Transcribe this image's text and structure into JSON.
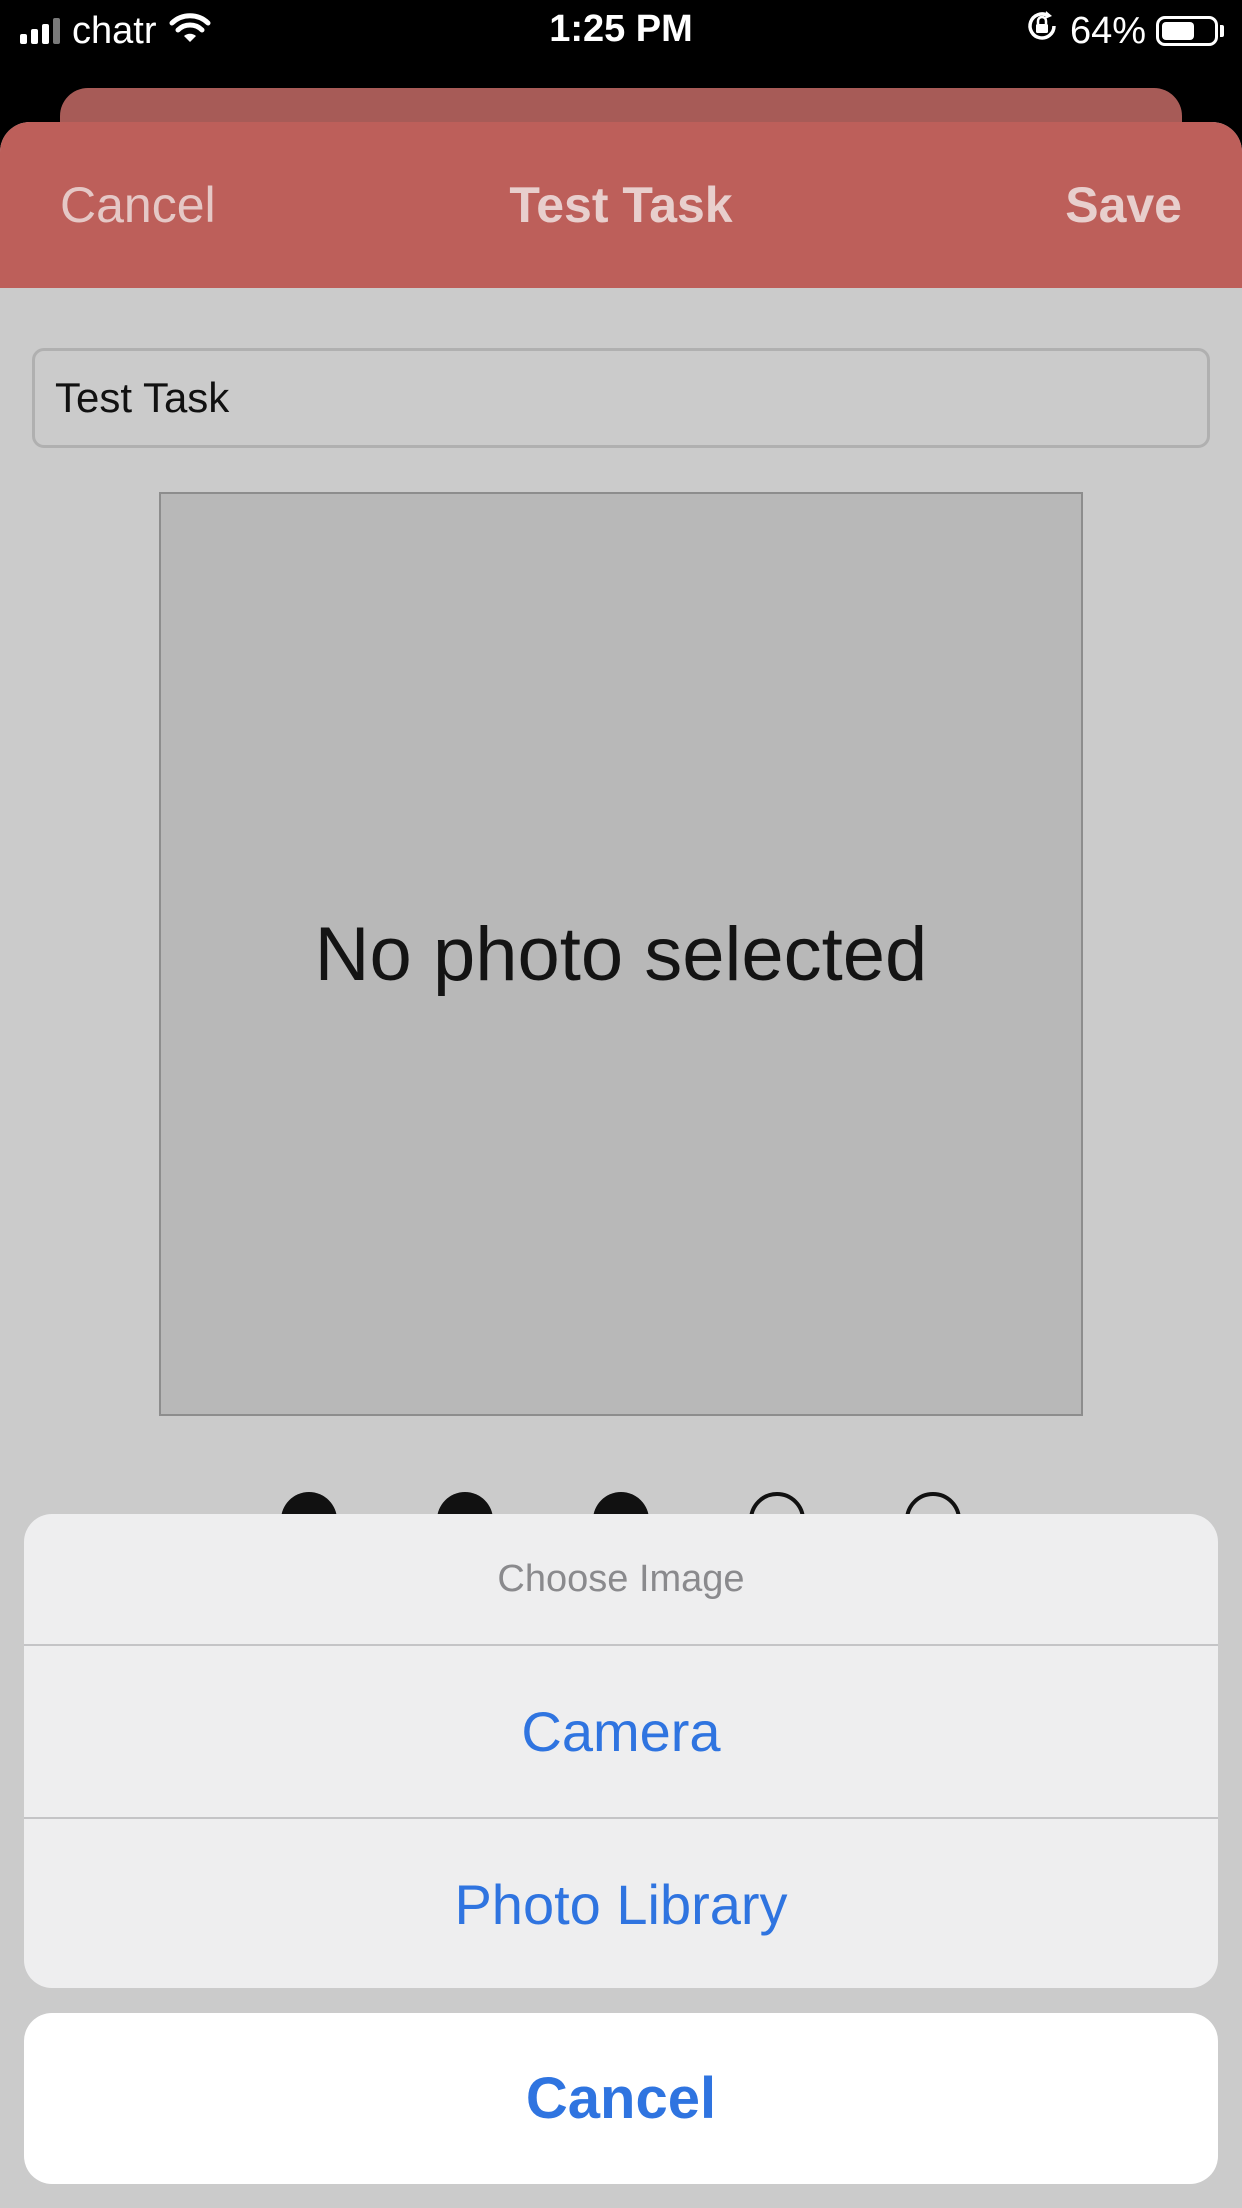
{
  "status_bar": {
    "carrier": "chatr",
    "time": "1:25 PM",
    "battery_percent": "64%",
    "battery_level": 0.64,
    "signal_bars_active": 3,
    "signal_bars_total": 4,
    "icons": [
      "signal-icon",
      "wifi-icon",
      "orientation-lock-icon",
      "battery-icon"
    ]
  },
  "navbar": {
    "cancel_label": "Cancel",
    "title": "Test Task",
    "save_label": "Save",
    "color": "#bd5f5a"
  },
  "form": {
    "task_name_value": "Test Task",
    "photo_placeholder": "No photo selected"
  },
  "page_indicator": {
    "total": 5,
    "filled": 3
  },
  "action_sheet": {
    "title": "Choose Image",
    "options": [
      {
        "label": "Camera"
      },
      {
        "label": "Photo Library"
      }
    ],
    "cancel_label": "Cancel",
    "accent_color": "#2f74e0"
  }
}
